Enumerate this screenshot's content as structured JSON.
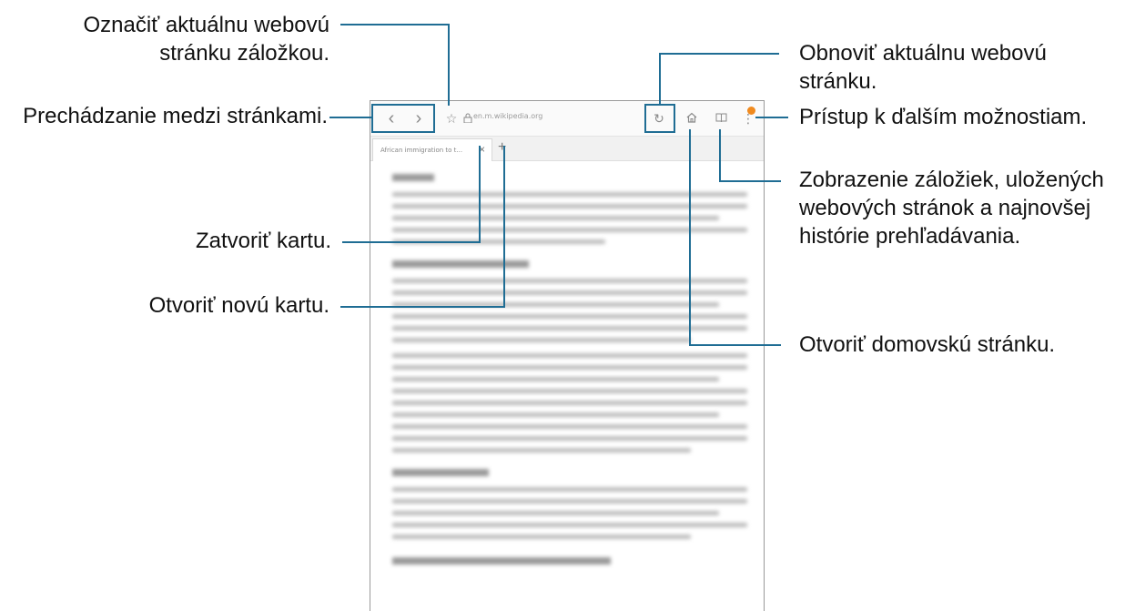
{
  "callouts": {
    "bookmark": "Označiť aktuálnu webovú stránku záložkou.",
    "navigate": "Prechádzanie medzi stránkami.",
    "close_tab": "Zatvoriť kartu.",
    "new_tab": "Otvoriť novú kartu.",
    "refresh": "Obnoviť aktuálnu webovú stránku.",
    "more_options": "Prístup k ďalším možnostiam.",
    "bookmarks_view": "Zobrazenie záložiek, uložených webových stránok a najnovšej histórie prehľadávania.",
    "home": "Otvoriť domovskú stránku."
  },
  "browser": {
    "url": "en.m.wikipedia.org",
    "tab_title": "African immigration to t...",
    "icons": {
      "back": "‹",
      "forward": "›",
      "star": "☆",
      "lock": "🔒",
      "refresh": "↻",
      "home": "⌂",
      "bookmarks": "📖",
      "more": "⋮",
      "close": "×",
      "plus": "+"
    }
  },
  "accent_color": "#1f6d94"
}
